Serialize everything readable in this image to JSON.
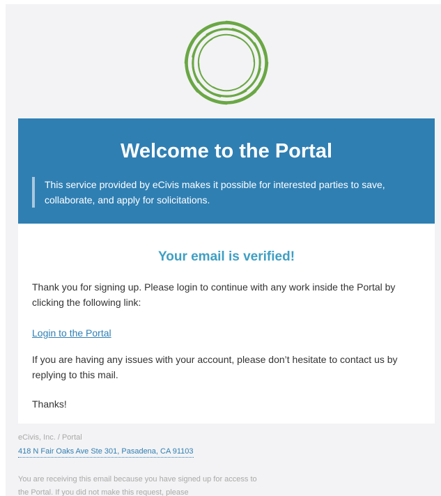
{
  "logo": {
    "icon": "ecivis-ring-logo-icon",
    "color": "#6aa744"
  },
  "banner": {
    "title": "Welcome to the Portal",
    "description": "This service provided by eCivis makes it possible for interested parties to save, collaborate, and apply for solicitations.",
    "background": "#2f7fb3"
  },
  "content": {
    "heading": "Your email is verified!",
    "intro": "Thank you for signing up. Please login to continue with any work inside the Portal by clicking the following link:",
    "login_link": "Login to the Portal",
    "issues": "If you are having any issues with your account, please don’t hesitate to contact us by replying to this mail.",
    "thanks": "Thanks!"
  },
  "footer": {
    "company": "eCivis, Inc. / Portal",
    "address": "418 N Fair Oaks Ave Ste 301, Pasadena, CA 91103",
    "note": "You are receiving this email because you have signed up for access to the Portal. If you did not make this request, please"
  }
}
